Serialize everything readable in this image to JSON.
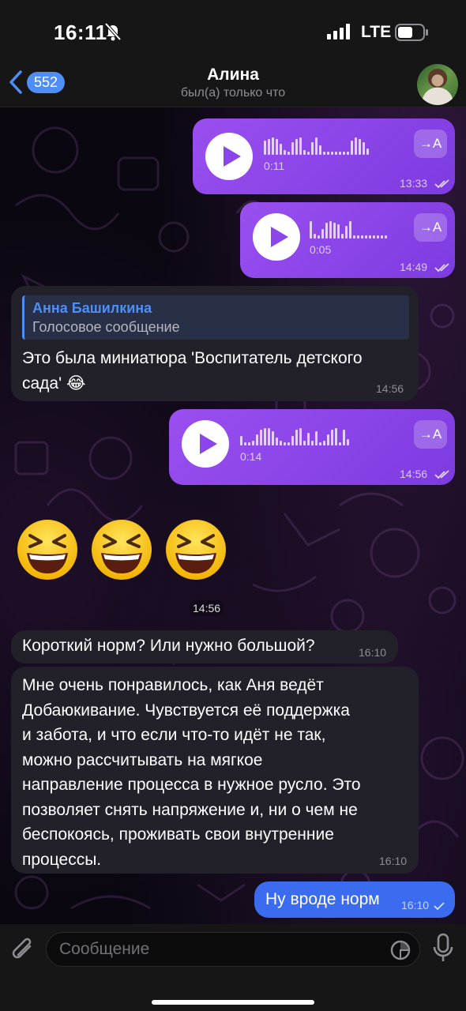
{
  "status": {
    "time": "16:11",
    "network": "LTE"
  },
  "header": {
    "back_count": "552",
    "title": "Алина",
    "subtitle": "был(а) только что"
  },
  "messages": {
    "voice1": {
      "duration": "0:11",
      "time": "13:33",
      "transcribe": "→A"
    },
    "voice2": {
      "duration": "0:05",
      "time": "14:49",
      "transcribe": "→A"
    },
    "reply": {
      "quoted_name": "Анна Башилкина",
      "quoted_text": "Голосовое сообщение",
      "line1": "Это была миниатюра 'Воспитатель детского",
      "line2": "сада' 😂",
      "time": "14:56"
    },
    "voice3": {
      "duration": "0:14",
      "time": "14:56",
      "transcribe": "→A"
    },
    "emoji_time": "14:56",
    "short_question": {
      "text": "Короткий норм? Или нужно большой?",
      "time": "16:10"
    },
    "long_text": {
      "lines": [
        "Мне очень понравилось, как Аня ведёт",
        "Добаюкивание. Чувствуется её поддержка",
        "и забота, и что если что-то идёт не так,",
        "можно рассчитывать на мягкое",
        "направление процесса в нужное русло. Это",
        "позволяет снять напряжение и, ни о чем не",
        "беспокоясь, проживать свои внутренние",
        "процессы."
      ],
      "time": "16:10"
    },
    "reply_out": {
      "text": "Ну вроде норм",
      "time": "16:10"
    }
  },
  "composer": {
    "placeholder": "Сообщение"
  },
  "colors": {
    "accent": "#4f8ef7",
    "outgoing": "#8a46ea",
    "incoming": "#222028"
  }
}
